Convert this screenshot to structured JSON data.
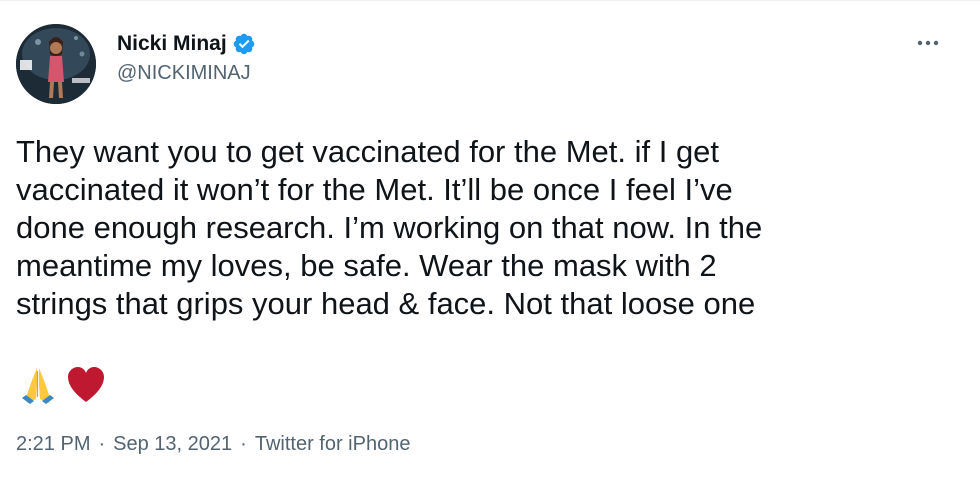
{
  "author": {
    "display_name": "Nicki Minaj",
    "handle": "@NICKIMINAJ",
    "verified": true,
    "avatar_icon": "profile-photo"
  },
  "menu": {
    "icon": "more-horizontal-icon"
  },
  "tweet": {
    "text_lines": [
      "They want you to get vaccinated for the Met. if I get",
      "vaccinated it won’t for the Met. It’ll be once I feel I’ve",
      "done enough research. I’m working on that now. In the",
      "meantime my loves, be safe. Wear the mask with 2",
      "strings that grips your head & face. Not that loose one"
    ],
    "emojis": [
      "folded-hands-emoji",
      "red-heart-emoji"
    ]
  },
  "meta": {
    "time": "2:21 PM",
    "separator": "·",
    "date": "Sep 13, 2021",
    "source": "Twitter for iPhone"
  },
  "colors": {
    "text_primary": "#0f1419",
    "text_secondary": "#536471",
    "verified_blue": "#1d9bf0",
    "heart_red": "#be1931"
  }
}
